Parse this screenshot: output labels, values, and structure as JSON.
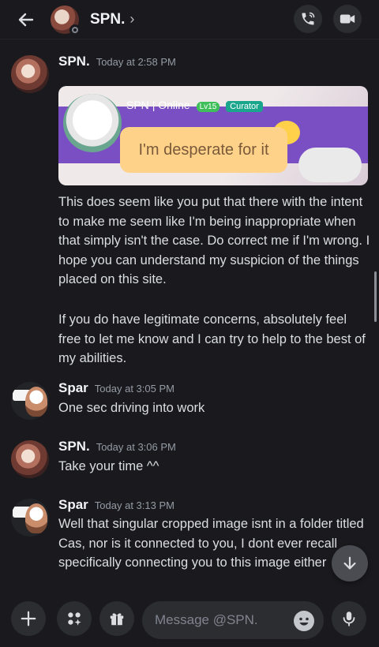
{
  "header": {
    "name": "SPN.",
    "chevron": "›",
    "back_icon": "arrow-left-icon",
    "call_icon": "phone-icon",
    "video_icon": "video-camera-icon"
  },
  "messages": [
    {
      "author": "SPN.",
      "time": "Today at 2:58 PM",
      "embed": {
        "tag_name": "SPN",
        "tag_status": "| Online",
        "level": "Lv15",
        "role": "Curator",
        "bubble_text": "I'm desperate for it"
      },
      "paragraphs": [
        "This does seem like you put that there with the intent to make me seem like I'm being inappropriate when that simply isn't the case. Do correct me if I'm wrong. I hope you can understand my suspicion of the things placed on this site.",
        "If you do have legitimate concerns, absolutely feel free to let me know and I can try to help to the best of my abilities."
      ]
    },
    {
      "author": "Spar",
      "time": "Today at 3:05 PM",
      "text": "One sec driving into work"
    },
    {
      "author": "SPN.",
      "time": "Today at 3:06 PM",
      "text": "Take your time ^^"
    },
    {
      "author": "Spar",
      "time": "Today at 3:13 PM",
      "text": "Well that singular cropped image isnt in a folder titled Cas, nor is it connected to you, I dont ever recall specifically connecting you to this image either"
    }
  ],
  "composer": {
    "placeholder": "Message @SPN.",
    "plus_icon": "plus-icon",
    "apps_icon": "apps-icon",
    "gift_icon": "gift-icon",
    "emoji_icon": "emoji-icon",
    "mic_icon": "microphone-icon"
  },
  "colors": {
    "background": "#1a1a1e",
    "button": "#2b2d31",
    "text": "#dbdee1",
    "timestamp": "#949ba4"
  }
}
